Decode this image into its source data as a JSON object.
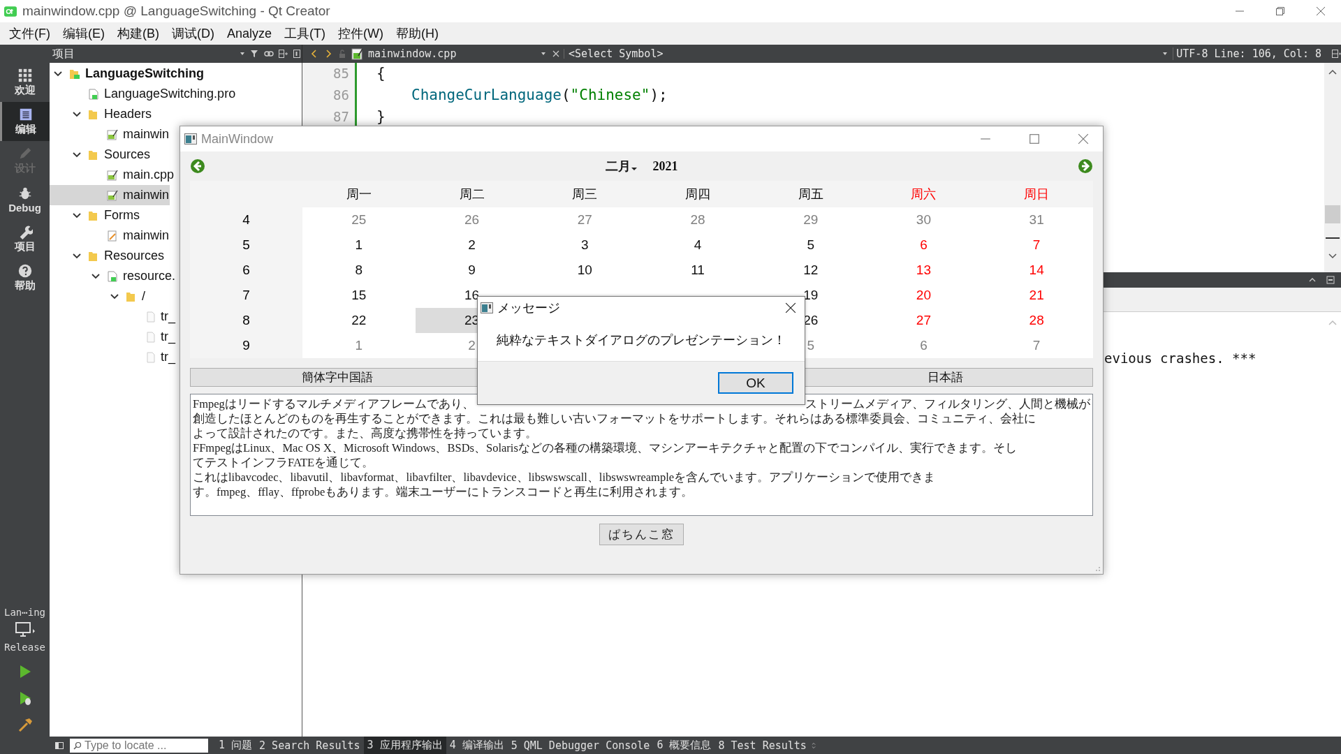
{
  "window": {
    "title": "mainwindow.cpp @ LanguageSwitching - Qt Creator"
  },
  "menu": [
    "文件(F)",
    "编辑(E)",
    "构建(B)",
    "调试(D)",
    "Analyze",
    "工具(T)",
    "控件(W)",
    "帮助(H)"
  ],
  "modes": [
    {
      "label": "欢迎",
      "kind": "welcome",
      "selected": false,
      "disabled": false
    },
    {
      "label": "编辑",
      "kind": "edit",
      "selected": true,
      "disabled": false
    },
    {
      "label": "设计",
      "kind": "design",
      "selected": false,
      "disabled": true
    },
    {
      "label": "Debug",
      "kind": "debug",
      "selected": false,
      "disabled": false
    },
    {
      "label": "项目",
      "kind": "projects",
      "selected": false,
      "disabled": false
    },
    {
      "label": "帮助",
      "kind": "help",
      "selected": false,
      "disabled": false
    }
  ],
  "target": {
    "project": "Lan⋯ing",
    "config": "Release"
  },
  "toolbar": {
    "panel_title": "项目",
    "file": "mainwindow.cpp",
    "symbol": "<Select Symbol>",
    "position": "UTF-8 Line: 106, Col: 8"
  },
  "tree": [
    {
      "label": "LanguageSwitching",
      "kind": "project",
      "expanded": true,
      "selected": false,
      "children": [
        {
          "label": "LanguageSwitching.pro",
          "kind": "file",
          "selected": false
        },
        {
          "label": "Headers",
          "kind": "folder",
          "expanded": true,
          "selected": false,
          "children": [
            {
              "label": "mainwin",
              "kind": "source",
              "selected": false
            }
          ]
        },
        {
          "label": "Sources",
          "kind": "folder",
          "expanded": true,
          "selected": false,
          "children": [
            {
              "label": "main.cpp",
              "kind": "source",
              "selected": false
            },
            {
              "label": "mainwin",
              "kind": "source",
              "selected": true
            }
          ]
        },
        {
          "label": "Forms",
          "kind": "folder",
          "expanded": true,
          "selected": false,
          "children": [
            {
              "label": "mainwin",
              "kind": "form",
              "selected": false
            }
          ]
        },
        {
          "label": "Resources",
          "kind": "folder",
          "expanded": true,
          "selected": false,
          "children": [
            {
              "label": "resource.",
              "kind": "file",
              "expanded": true,
              "selected": false,
              "children": [
                {
                  "label": "/",
                  "kind": "folder",
                  "expanded": true,
                  "selected": false,
                  "children": [
                    {
                      "label": "tr_",
                      "kind": "plain",
                      "selected": false
                    },
                    {
                      "label": "tr_",
                      "kind": "plain",
                      "selected": false
                    },
                    {
                      "label": "tr_",
                      "kind": "plain",
                      "selected": false
                    }
                  ]
                }
              ]
            }
          ]
        }
      ]
    }
  ],
  "editor": {
    "lines": [
      {
        "number": "85",
        "tokens": [
          {
            "kind": "plain",
            "text": "{"
          }
        ]
      },
      {
        "number": "86",
        "indent": true,
        "tokens": [
          {
            "kind": "function",
            "text": "ChangeCurLanguage"
          },
          {
            "kind": "plain",
            "text": "("
          },
          {
            "kind": "string",
            "text": "\"Chinese\""
          },
          {
            "kind": "plain",
            "text": ");"
          }
        ]
      },
      {
        "number": "87",
        "tokens": [
          {
            "kind": "plain",
            "text": "}"
          }
        ]
      }
    ]
  },
  "output": {
    "text": "evious crashes. ***"
  },
  "status_bar": {
    "locator_placeholder": "Type to locate ...",
    "panes": [
      {
        "label": "1 问题",
        "selected": false
      },
      {
        "label": "2 Search Results",
        "selected": false
      },
      {
        "label": "3 应用程序输出",
        "selected": true
      },
      {
        "label": "4 编译输出",
        "selected": false
      },
      {
        "label": "5 QML Debugger Console",
        "selected": false
      },
      {
        "label": "6 概要信息",
        "selected": false
      },
      {
        "label": "8 Test Results",
        "selected": false
      }
    ]
  },
  "app_window": {
    "title": "MainWindow",
    "calendar": {
      "month": "二月",
      "year": "2021",
      "weekdays": [
        {
          "label": "周一",
          "weekend": false
        },
        {
          "label": "周二",
          "weekend": false
        },
        {
          "label": "周三",
          "weekend": false
        },
        {
          "label": "周四",
          "weekend": false
        },
        {
          "label": "周五",
          "weekend": false
        },
        {
          "label": "周六",
          "weekend": true
        },
        {
          "label": "周日",
          "weekend": true
        }
      ],
      "weeks": [
        {
          "number": "4",
          "days": [
            {
              "d": "25",
              "kind": "other",
              "selected": false
            },
            {
              "d": "26",
              "kind": "other",
              "selected": false
            },
            {
              "d": "27",
              "kind": "other",
              "selected": false
            },
            {
              "d": "28",
              "kind": "other",
              "selected": false
            },
            {
              "d": "29",
              "kind": "other",
              "selected": false
            },
            {
              "d": "30",
              "kind": "other",
              "selected": false
            },
            {
              "d": "31",
              "kind": "other",
              "selected": false
            }
          ]
        },
        {
          "number": "5",
          "days": [
            {
              "d": "1",
              "kind": "normal",
              "selected": false
            },
            {
              "d": "2",
              "kind": "normal",
              "selected": false
            },
            {
              "d": "3",
              "kind": "normal",
              "selected": false
            },
            {
              "d": "4",
              "kind": "normal",
              "selected": false
            },
            {
              "d": "5",
              "kind": "normal",
              "selected": false
            },
            {
              "d": "6",
              "kind": "normal",
              "selected": false
            },
            {
              "d": "7",
              "kind": "normal",
              "selected": false
            }
          ]
        },
        {
          "number": "6",
          "days": [
            {
              "d": "8",
              "kind": "normal",
              "selected": false
            },
            {
              "d": "9",
              "kind": "normal",
              "selected": false
            },
            {
              "d": "10",
              "kind": "normal",
              "selected": false
            },
            {
              "d": "11",
              "kind": "normal",
              "selected": false
            },
            {
              "d": "12",
              "kind": "normal",
              "selected": false
            },
            {
              "d": "13",
              "kind": "normal",
              "selected": false
            },
            {
              "d": "14",
              "kind": "normal",
              "selected": false
            }
          ]
        },
        {
          "number": "7",
          "days": [
            {
              "d": "15",
              "kind": "normal",
              "selected": false
            },
            {
              "d": "16",
              "kind": "normal",
              "selected": false
            },
            {
              "kind": "hidden"
            },
            {
              "kind": "hidden"
            },
            {
              "d": "19",
              "kind": "normal",
              "selected": false
            },
            {
              "d": "20",
              "kind": "normal",
              "selected": false
            },
            {
              "d": "21",
              "kind": "normal",
              "selected": false
            }
          ]
        },
        {
          "number": "8",
          "days": [
            {
              "d": "22",
              "kind": "normal",
              "selected": false
            },
            {
              "d": "23",
              "kind": "normal",
              "selected": true
            },
            {
              "kind": "covered"
            },
            {
              "kind": "covered"
            },
            {
              "d": "26",
              "kind": "normal",
              "selected": false
            },
            {
              "d": "27",
              "kind": "normal",
              "selected": false
            },
            {
              "d": "28",
              "kind": "normal",
              "selected": false
            }
          ]
        },
        {
          "number": "9",
          "days": [
            {
              "d": "1",
              "kind": "other",
              "selected": false
            },
            {
              "d": "2",
              "kind": "other",
              "selected": false
            },
            {
              "kind": "covered"
            },
            {
              "kind": "covered"
            },
            {
              "d": "5",
              "kind": "other",
              "selected": false
            },
            {
              "d": "6",
              "kind": "other",
              "selected": false
            },
            {
              "d": "7",
              "kind": "other",
              "selected": false
            }
          ]
        }
      ]
    },
    "language_buttons": [
      {
        "kind": "button",
        "label": "簡体字中国語"
      },
      {
        "kind": "hidden"
      },
      {
        "kind": "button",
        "label": "日本語"
      }
    ],
    "text_lines": [
      [
        "Fmpegはリードするマルチメディアフレームであり、",
        "ストリームメディア、フィルタリング、人間と機械が"
      ],
      [
        "創造したほとんどのものを再生することができます。これは最も難しい古いフォーマットをサポートします。それらはある標準委員会、コミュニティ、会社に"
      ],
      [
        "よって設計されたのです。また、高度な携帯性を持っています。"
      ],
      [
        "FFmpegはLinux、Mac OS X、Microsoft Windows、BSDs、Solarisなどの各種の構築環境、マシンアーキテクチャと配置の下でコンパイル、実行できます。そし"
      ],
      [
        "てテストインフラFATEを通じて。"
      ],
      [
        "これはlibavcodec、libavutil、libavformat、libavfilter、libavdevice、libswswscall、libswswreampleを含んでいます。アプリケーションで使用できま"
      ],
      [
        "す。fmpeg、fflay、ffprobeもあります。端末ユーザーにトランスコードと再生に利用されます。"
      ]
    ],
    "popup_button": "ぱちんこ窓"
  },
  "dialog": {
    "title": "メッセージ",
    "message": "純粋なテキストダイアログのプレゼンテーション！",
    "button": "OK"
  }
}
